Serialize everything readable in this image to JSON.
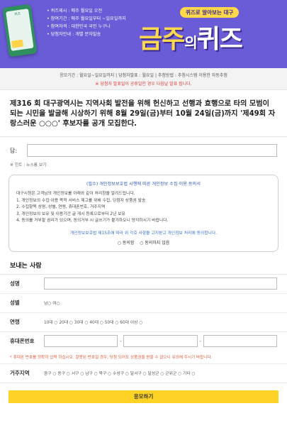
{
  "banner": {
    "bullets": [
      "• 퀴즈제시 : 매주 월요일 오전",
      "• 참여기간 : 매주 월요일부터 ~일요일까지",
      "• 참여자격 : 대한민국 국민 누구나",
      "• 당첨자안내 : 개별 문자발송"
    ],
    "subtitle": "퀴즈로 알아보는 대구",
    "title_main": "금주",
    "title_small": "의",
    "title_end": "퀴즈"
  },
  "info": {
    "line1": "응모기간 : 월요일~일요일까지 | 당첨자발표 : 월요일 | 추첨방법 : 추첨시스템 이용한 자동추첨",
    "line2": "※ 당첨자 발표일이 공휴일인 경우 다음날 발표 됩니다."
  },
  "intro": "제316 회 대구광역시는 지역사회 발전을 위해 헌신하고 선행과 효행으로 타의 모범이 되는 시민을 발굴해 시상하기 위해 8월 29일(금)부터 10월 24일(금)까지 '제49회 자랑스러운 ○○○' 후보자를 공개 모집한다.",
  "answer": {
    "label": "답:"
  },
  "hint": "※ 힌트 : 뉴스룸 보기",
  "consent": {
    "heading": "(필수) 개인정보보호법 시행에 따른 개인정보 수집·이용 동의서",
    "body": [
      "대구시청은 고객님의 개인정보를 아래와 같이 처리함을 알려드립니다.",
      "1. 개인정보의 수집·이용 목적 서비스 제고를 위해 수집, 당첨자 상품권 발송",
      "2. 수집항목 성명, 성별, 연령, 휴대폰번호, 거주지역",
      "3. 개인정보의 보유 및 이용기간 글 게시 등록으로부터 2년 보유",
      "4. 동의를 거부할 권리가 있으며, 동의거부 시 글쓰기가 불가하오니 양지하시기 바랍니다."
    ],
    "note": "개인정보보호법 제15조에 따라 위 각호 사항을 고지받고 개인정보 처리에 동의합니다.",
    "agree": "○ 동의함",
    "disagree": "○ 동의하지 않음"
  },
  "sender": {
    "title": "보내는 사람",
    "name_label": "성명",
    "gender_label": "성별",
    "gender_options": "남○ 여○",
    "age_label": "연령",
    "age_options": "10대 ○ 20대 ○ 30대 ○ 40대 ○ 50대 ○ 60대 이상 ○",
    "phone_label": "휴대폰번호",
    "phone_sep": "-",
    "warning": "* 휴대폰 번호를 정확히 입력 하십시오. 잘못된 번호일 경우, 당첨 되어도 상품권을 받을 수 없으니 유의해 주시기 바랍니다.",
    "region_label": "거주지역",
    "region_options": "중구 ○ 동구 ○ 서구 ○ 남구 ○ 북구 ○ 수성구 ○ 달서구 ○ 달성군 ○ 군위군 ○ 기타 ○"
  },
  "submit_label": "응모하기"
}
